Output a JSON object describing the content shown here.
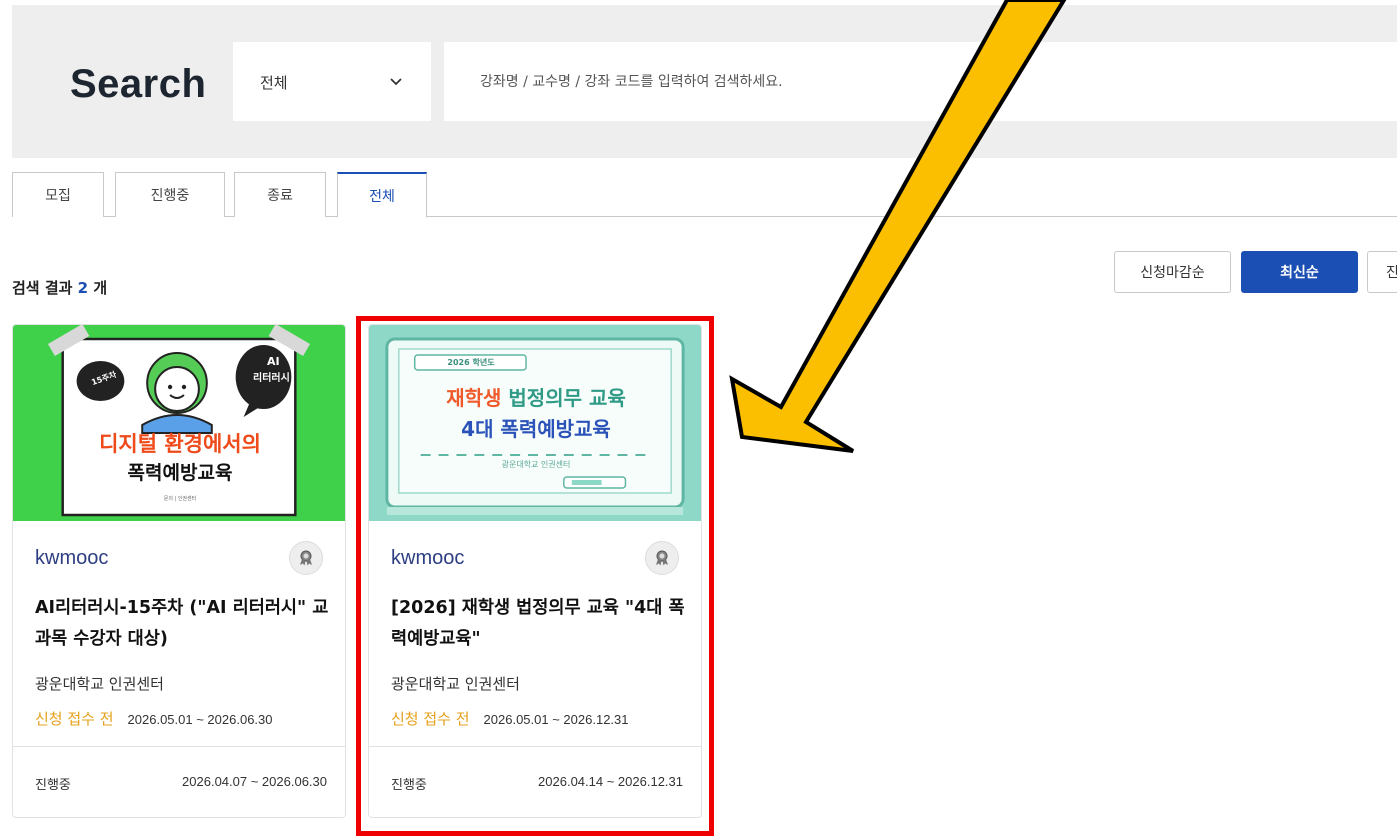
{
  "search": {
    "title": "Search",
    "category_selected": "전체",
    "placeholder": "강좌명 / 교수명 / 강좌 코드를 입력하여 검색하세요."
  },
  "tabs": [
    {
      "label": "모집",
      "active": false
    },
    {
      "label": "진행중",
      "active": false
    },
    {
      "label": "종료",
      "active": false
    },
    {
      "label": "전체",
      "active": true
    }
  ],
  "results": {
    "label": "검색 결과",
    "count": "2",
    "unit": "개"
  },
  "sort": [
    {
      "label": "신청마감순",
      "active": false
    },
    {
      "label": "최신순",
      "active": true
    },
    {
      "label": "진",
      "active": false
    }
  ],
  "courses": [
    {
      "org": "kwmooc",
      "title": "AI리터러시-15주차 (\"AI 리터러시\" 교과목 수강자 대상)",
      "institution": "광운대학교 인권센터",
      "status": "신청 접수 전",
      "apply_period": "2026.05.01 ~ 2026.06.30",
      "progress_label": "진행중",
      "course_period": "2026.04.07 ~ 2026.06.30",
      "badge_icon": "certificate-icon",
      "thumb": {
        "bubble_left": "15주차",
        "bubble_right_1": "AI",
        "bubble_right_2": "리터러시",
        "headline_1": "디지털 환경에서의",
        "headline_2": "폭력예방교육",
        "footer_note": "문의 | 인권센터"
      }
    },
    {
      "org": "kwmooc",
      "title": "[2026] 재학생 법정의무 교육 \"4대 폭력예방교육\"",
      "institution": "광운대학교 인권센터",
      "status": "신청 접수 전",
      "apply_period": "2026.05.01 ~ 2026.12.31",
      "progress_label": "진행중",
      "course_period": "2026.04.14 ~ 2026.12.31",
      "badge_icon": "certificate-icon",
      "thumb": {
        "tag": "2026 학년도",
        "line1_a": "재학생",
        "line1_b": "법정의무 교육",
        "line2": "4대 폭력예방교육",
        "sub": "광운대학교 인권센터"
      }
    }
  ],
  "colors": {
    "accent": "#1b4fb3",
    "status": "#e6a01c",
    "org": "#2d3e82",
    "annotation_box": "#ee0000",
    "annotation_arrow": "#fbbf00"
  }
}
